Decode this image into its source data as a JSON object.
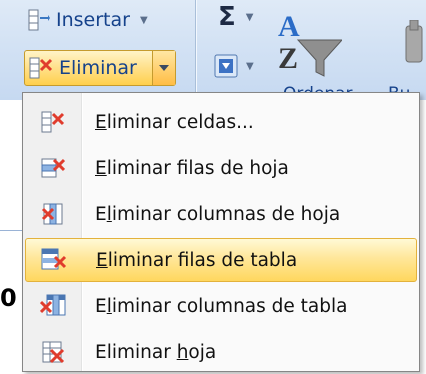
{
  "ribbon": {
    "insert_button": {
      "label": "Insertar",
      "icon": "insert-rows-icon"
    },
    "delete_button": {
      "label": "Eliminar",
      "icon": "delete-cells-icon"
    },
    "autosum_button": {
      "label": "Σ",
      "icon": "sigma-icon"
    },
    "fill_button": {
      "icon": "fill-down-icon"
    },
    "sort_filter_button": {
      "label_cut": "Ordenar",
      "icon": "sort-filter-icon"
    },
    "find_button": {
      "label_cut": "Bu",
      "icon": "find-select-icon"
    }
  },
  "sheet": {
    "partial_cell_text": "0"
  },
  "menu": {
    "items": [
      {
        "pre": "",
        "mnemonic": "E",
        "post": "liminar celdas...",
        "icon": "delete-cells-icon",
        "selected": false
      },
      {
        "pre": "",
        "mnemonic": "E",
        "post": "liminar filas de hoja",
        "icon": "delete-sheet-rows-icon",
        "selected": false
      },
      {
        "pre": "E",
        "mnemonic": "l",
        "post": "iminar columnas de hoja",
        "icon": "delete-sheet-columns-icon",
        "selected": false
      },
      {
        "pre": "",
        "mnemonic": "E",
        "post": "liminar filas de tabla",
        "icon": "delete-table-rows-icon",
        "selected": true
      },
      {
        "pre": "E",
        "mnemonic": "l",
        "post": "iminar columnas de tabla",
        "icon": "delete-table-columns-icon",
        "selected": false
      },
      {
        "pre": "Eliminar ",
        "mnemonic": "h",
        "post": "oja",
        "icon": "delete-sheet-icon",
        "selected": false
      }
    ]
  },
  "colors": {
    "ribbon_text": "#15428b",
    "highlight_top": "#fffad6",
    "highlight_bottom": "#ffd75e",
    "highlight_border": "#e3b23c",
    "delete_red": "#e03c2d"
  }
}
